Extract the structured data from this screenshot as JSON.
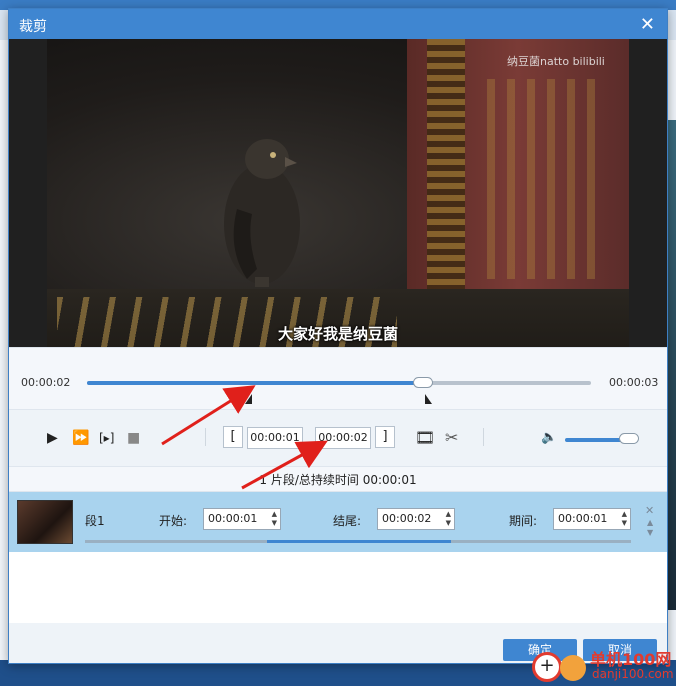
{
  "dialog": {
    "title": "裁剪",
    "close_glyph": "✕"
  },
  "video": {
    "watermark": "纳豆菌natto bilibili",
    "subtitle": "大家好我是纳豆菌"
  },
  "timeline": {
    "current_time": "00:00:02",
    "total_time": "00:00:03",
    "progress_fraction": 0.67
  },
  "controls": {
    "play_icon": "▶",
    "fast_forward_icon": "⏩",
    "clip_icon": "[▸]",
    "stop_icon": "■",
    "set_start_label": "[",
    "start_time": "00:00:01",
    "end_time": "00:00:02",
    "set_end_label": "]",
    "film_icon": "🎞",
    "scissor_icon": "✂",
    "volume_icon": "🔈"
  },
  "summary": "1 片段/总持续时间 00:00:01",
  "segments": [
    {
      "label": "段1",
      "start_label": "开始:",
      "start_value": "00:00:01",
      "end_label": "结尾:",
      "end_value": "00:00:02",
      "duration_label": "期间:",
      "duration_value": "00:00:01"
    }
  ],
  "footer": {
    "ok_label": "确定",
    "cancel_label": "取消"
  },
  "site_watermark": {
    "name": "单机100网",
    "url": "danji100.com"
  },
  "colors": {
    "accent": "#3f86d1",
    "row_selected": "#a9d3ee",
    "annotation_arrow": "#e0201b"
  }
}
